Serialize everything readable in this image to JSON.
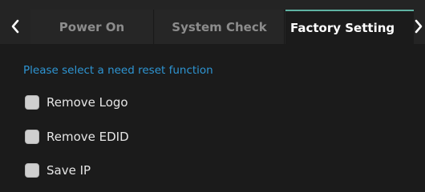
{
  "tabs": [
    {
      "label": "Power On",
      "active": false
    },
    {
      "label": "System Check",
      "active": false
    },
    {
      "label": "Factory Setting",
      "active": true
    }
  ],
  "navigation": {
    "prev_icon": "chevron-left-icon",
    "next_icon": "chevron-right-icon"
  },
  "factory_setting": {
    "prompt": "Please select a need reset function",
    "options": [
      {
        "label": "Remove Logo",
        "checked": false
      },
      {
        "label": "Remove EDID",
        "checked": false
      },
      {
        "label": "Save IP",
        "checked": false
      }
    ]
  },
  "colors": {
    "prompt": "#2e95d3",
    "active_tab_accent": "#5fb2a3",
    "background": "#1b1b1b"
  }
}
